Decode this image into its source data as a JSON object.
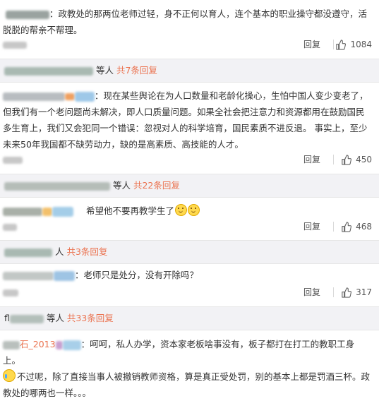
{
  "comments": [
    {
      "text": "：政教处的那两位老师过轻，身不正何以育人，连个基本的职业操守都没遵守，活脱脱的帮亲不帮理。",
      "reply_label": "回复",
      "likes": "1084",
      "sub": {
        "suffix": "等人",
        "more": "共7条回复"
      }
    },
    {
      "text": "：现在某些舆论在为人口数量和老龄化操心，生怕中国人变少变老了，但我们有一个老问题尚未解决，即人口质量问题。如果全社会把注意力和资源都用在鼓励国民多生育上，我们又会犯同一个错误：忽视对人的科学培育，国民素质不进反退。 事实上，至少未来50年我国都不缺劳动力，缺的是高素质、高技能的人才。",
      "reply_label": "回复",
      "likes": "450",
      "sub": {
        "suffix": "等人",
        "more": "共22条回复"
      }
    },
    {
      "text": "希望他不要再教学生了",
      "reply_label": "回复",
      "likes": "468",
      "sub": {
        "suffix": "人",
        "more": "共3条回复"
      }
    },
    {
      "text": "：老师只是处分，没有开除吗？",
      "reply_label": "回复",
      "likes": "317",
      "sub": {
        "prefix": "fl",
        "suffix": "等人",
        "more": "共33条回复"
      }
    },
    {
      "name_visible": "石_2013",
      "text1": "：呵呵，私人办学，资本家老板啥事没有，板子都打在打工的教职工身上。",
      "text2": "不过呢，除了直接当事人被撤销教师资格，算是真正受处罚，别的基本上都是罚酒三杯。政教处的哪两也一样。。。"
    }
  ],
  "colors": {
    "accent": "#eb7350",
    "text": "#333333",
    "bar_bg": "#f2f2f5"
  },
  "icons": [
    "thumbs-up-icon",
    "smile-emoji-icon",
    "cry-emoji-icon"
  ]
}
